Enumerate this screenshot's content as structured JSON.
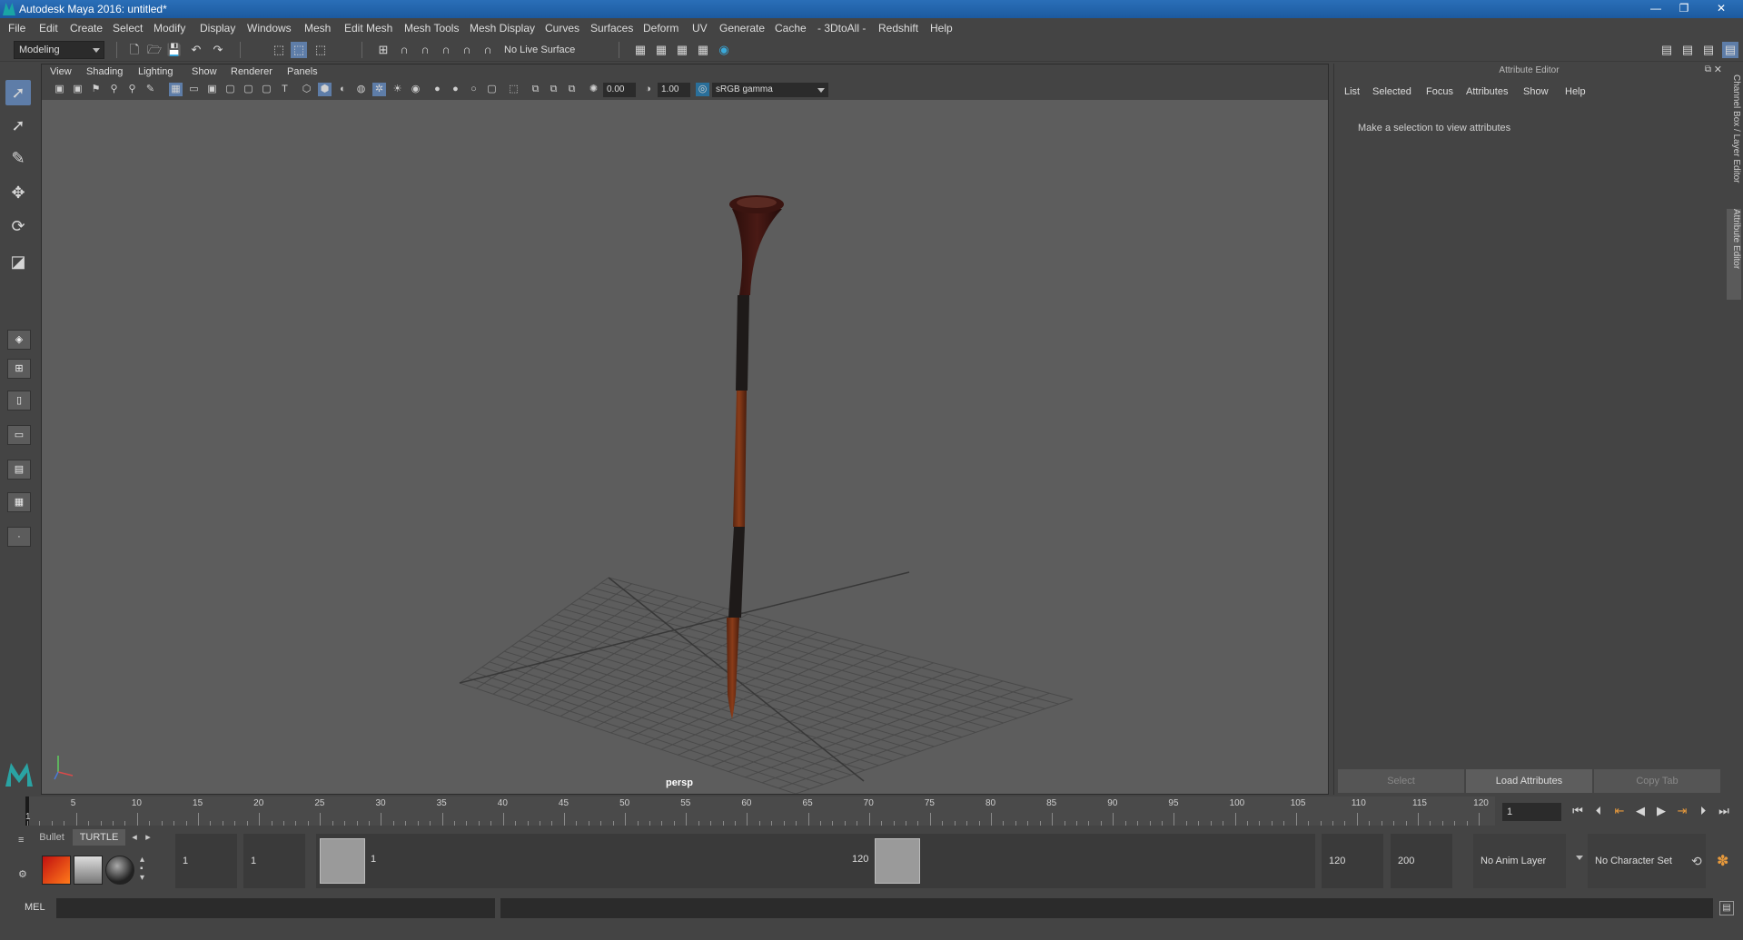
{
  "window": {
    "title": "Autodesk Maya 2016: untitled*",
    "minimize": "—",
    "restore": "❐",
    "close": "✕"
  },
  "menu": [
    "File",
    "Edit",
    "Create",
    "Select",
    "Modify",
    "Display",
    "Windows",
    "Mesh",
    "Edit Mesh",
    "Mesh Tools",
    "Mesh Display",
    "Curves",
    "Surfaces",
    "Deform",
    "UV",
    "Generate",
    "Cache",
    "- 3DtoAll -",
    "Redshift",
    "Help"
  ],
  "statusline": {
    "menuset": "Modeling",
    "live_surface": "No Live Surface"
  },
  "viewport": {
    "menu": [
      "View",
      "Shading",
      "Lighting",
      "Show",
      "Renderer",
      "Panels"
    ],
    "exposure": "0.00",
    "gamma": "1.00",
    "color_space": "sRGB gamma",
    "camera_label": "persp"
  },
  "attribute_editor": {
    "title": "Attribute Editor",
    "menu": [
      "List",
      "Selected",
      "Focus",
      "Attributes",
      "Show",
      "Help"
    ],
    "message": "Make a selection to view attributes",
    "buttons": [
      "Select",
      "Load Attributes",
      "Copy Tab"
    ],
    "side_tabs": [
      "Channel Box / Layer Editor",
      "Attribute Editor"
    ]
  },
  "timeslider": {
    "ruler": [
      "5",
      "10",
      "15",
      "20",
      "25",
      "30",
      "35",
      "40",
      "45",
      "50",
      "55",
      "60",
      "65",
      "70",
      "75",
      "80",
      "85",
      "90",
      "95",
      "100",
      "105",
      "110",
      "115",
      "120"
    ],
    "start_marker": "1",
    "current_frame": "1"
  },
  "shelf": {
    "tabs": [
      "Bullet",
      "TURTLE"
    ]
  },
  "range": {
    "start": "1",
    "playback_start": "1",
    "range_start_label": "1",
    "range_end_label": "120",
    "playback_end": "120",
    "end": "200",
    "anim_layer": "No Anim Layer",
    "character_set": "No Character Set"
  },
  "cmdline": {
    "label": "MEL"
  },
  "colors": {
    "accent": "#5e7da8",
    "viewport_bg": "#5d5d5d",
    "model_dark": "#3b1512",
    "model_wood": "#7a3417"
  }
}
